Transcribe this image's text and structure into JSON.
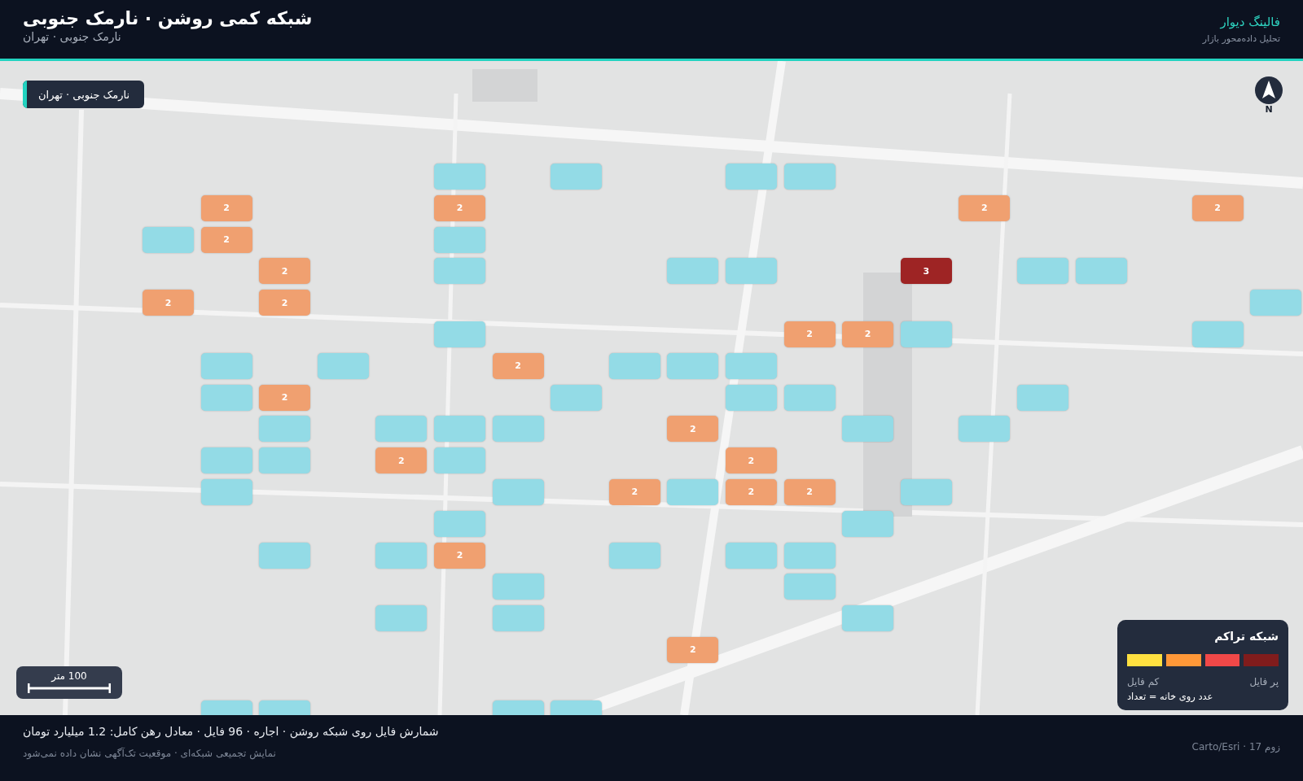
{
  "header": {
    "title": "شبکه کمی روشن · نارمک جنوبی",
    "subtitle": "نارمک جنوبی · تهران",
    "brand": "فالینگ دیوار",
    "tagline": "تحلیل داده‌محور بازار"
  },
  "map": {
    "kind": "picture",
    "location_badge": "نارمک جنوبی · تهران",
    "north_label": "N",
    "scale_label": "100 متر",
    "grid_rows": [
      {
        "cells": [
          {},
          {},
          {},
          {},
          {},
          {},
          {},
          {},
          {
            "color": "#93dbe6"
          },
          {
            "color": "#93dbe6"
          },
          {},
          {},
          {
            "color": "#93dbe6"
          },
          {},
          {
            "color": "#93dbe6"
          },
          {},
          {},
          {},
          {},
          {}
        ]
      },
      {
        "cells": [
          {},
          {
            "color": "#f0a070",
            "count": "2"
          },
          {},
          {},
          {},
          {
            "color": "#f0a070",
            "count": "2"
          },
          {},
          {},
          {},
          {},
          {},
          {},
          {},
          {},
          {
            "color": "#f0a070",
            "count": "2"
          },
          {},
          {},
          {},
          {
            "color": "#f0a070",
            "count": "2"
          },
          {}
        ]
      },
      {
        "cells": [
          {},
          {},
          {},
          {},
          {},
          {},
          {},
          {},
          {},
          {},
          {},
          {},
          {},
          {},
          {
            "color": "#93dbe6"
          },
          {},
          {},
          {},
          {
            "color": "#f0a070",
            "count": "2"
          },
          {
            "color": "#93dbe6"
          }
        ]
      },
      {
        "cells": [
          {},
          {},
          {},
          {
            "color": "#93dbe6"
          },
          {
            "color": "#93dbe6"
          },
          {},
          {
            "color": "#9e2424",
            "count": "3"
          },
          {},
          {},
          {
            "color": "#93dbe6"
          },
          {
            "color": "#93dbe6"
          },
          {},
          {},
          {},
          {
            "color": "#93dbe6"
          },
          {},
          {},
          {
            "color": "#f0a070",
            "count": "2"
          },
          {},
          {}
        ]
      },
      {
        "cells": [
          {
            "color": "#93dbe6"
          },
          {},
          {},
          {},
          {},
          {},
          {},
          {},
          {},
          {},
          {},
          {},
          {},
          {},
          {},
          {},
          {},
          {
            "color": "#f0a070",
            "count": "2"
          },
          {},
          {
            "color": "#f0a070",
            "count": "2"
          }
        ]
      },
      {
        "cells": [
          {},
          {
            "color": "#93dbe6"
          },
          {},
          {},
          {},
          {},
          {
            "color": "#93dbe6"
          },
          {
            "color": "#f0a070",
            "count": "2"
          },
          {
            "color": "#f0a070",
            "count": "2"
          },
          {},
          {},
          {},
          {},
          {},
          {
            "color": "#93dbe6"
          },
          {},
          {},
          {},
          {},
          {}
        ]
      },
      {
        "cells": [
          {},
          {},
          {},
          {},
          {},
          {},
          {},
          {},
          {},
          {
            "color": "#93dbe6"
          },
          {
            "color": "#93dbe6"
          },
          {
            "color": "#93dbe6"
          },
          {},
          {
            "color": "#f0a070",
            "count": "2"
          },
          {},
          {},
          {
            "color": "#93dbe6"
          },
          {},
          {
            "color": "#93dbe6"
          },
          {}
        ]
      },
      {
        "cells": [
          {},
          {},
          {},
          {},
          {
            "color": "#93dbe6"
          },
          {},
          {},
          {},
          {
            "color": "#93dbe6"
          },
          {
            "color": "#93dbe6"
          },
          {},
          {},
          {
            "color": "#93dbe6"
          },
          {},
          {},
          {},
          {},
          {
            "color": "#f0a070",
            "count": "2"
          },
          {
            "color": "#93dbe6"
          },
          {}
        ]
      },
      {
        "cells": [
          {},
          {},
          {},
          {},
          {},
          {
            "color": "#93dbe6"
          },
          {},
          {
            "color": "#93dbe6"
          },
          {},
          {},
          {
            "color": "#f0a070",
            "count": "2"
          },
          {},
          {},
          {
            "color": "#93dbe6"
          },
          {
            "color": "#93dbe6"
          },
          {
            "color": "#93dbe6"
          },
          {},
          {
            "color": "#93dbe6"
          },
          {},
          {}
        ]
      },
      {
        "cells": [
          {},
          {},
          {},
          {},
          {},
          {},
          {},
          {},
          {},
          {
            "color": "#f0a070",
            "count": "2"
          },
          {},
          {},
          {},
          {},
          {
            "color": "#93dbe6"
          },
          {
            "color": "#f0a070",
            "count": "2"
          },
          {},
          {
            "color": "#93dbe6"
          },
          {
            "color": "#93dbe6"
          },
          {}
        ]
      },
      {
        "cells": [
          {},
          {},
          {},
          {},
          {},
          {},
          {
            "color": "#93dbe6"
          },
          {},
          {
            "color": "#f0a070",
            "count": "2"
          },
          {
            "color": "#f0a070",
            "count": "2"
          },
          {
            "color": "#93dbe6"
          },
          {
            "color": "#f0a070",
            "count": "2"
          },
          {},
          {
            "color": "#93dbe6"
          },
          {},
          {},
          {},
          {},
          {
            "color": "#93dbe6"
          },
          {}
        ]
      },
      {
        "cells": [
          {},
          {},
          {},
          {},
          {},
          {},
          {},
          {
            "color": "#93dbe6"
          },
          {},
          {},
          {},
          {},
          {},
          {},
          {
            "color": "#93dbe6"
          },
          {},
          {},
          {},
          {},
          {}
        ]
      },
      {
        "cells": [
          {},
          {},
          {},
          {},
          {},
          {},
          {},
          {},
          {
            "color": "#93dbe6"
          },
          {
            "color": "#93dbe6"
          },
          {},
          {
            "color": "#93dbe6"
          },
          {},
          {},
          {
            "color": "#f0a070",
            "count": "2"
          },
          {
            "color": "#93dbe6"
          },
          {},
          {
            "color": "#93dbe6"
          },
          {},
          {}
        ]
      },
      {
        "cells": [
          {},
          {},
          {},
          {},
          {},
          {},
          {},
          {},
          {
            "color": "#93dbe6"
          },
          {},
          {},
          {},
          {},
          {
            "color": "#93dbe6"
          },
          {},
          {},
          {},
          {},
          {},
          {}
        ]
      },
      {
        "cells": [
          {},
          {},
          {},
          {},
          {},
          {},
          {},
          {
            "color": "#93dbe6"
          },
          {},
          {},
          {},
          {},
          {},
          {
            "color": "#93dbe6"
          },
          {},
          {
            "color": "#93dbe6"
          },
          {},
          {},
          {},
          {}
        ]
      },
      {
        "cells": [
          {},
          {},
          {},
          {},
          {},
          {},
          {},
          {},
          {},
          {},
          {
            "color": "#f0a070",
            "count": "2"
          },
          {},
          {},
          {},
          {},
          {},
          {},
          {},
          {},
          {}
        ]
      },
      {
        "cells": [
          {},
          {},
          {},
          {},
          {},
          {},
          {},
          {},
          {},
          {},
          {},
          {},
          {},
          {},
          {},
          {},
          {},
          {},
          {},
          {}
        ]
      },
      {
        "cells": [
          {},
          {},
          {},
          {},
          {},
          {},
          {},
          {},
          {},
          {},
          {},
          {},
          {
            "color": "#93dbe6"
          },
          {
            "color": "#93dbe6"
          },
          {},
          {},
          {},
          {
            "color": "#93dbe6"
          },
          {
            "color": "#93dbe6"
          },
          {}
        ]
      }
    ]
  },
  "legend": {
    "title": "شبکه تراکم",
    "swatches": [
      {
        "color": "#ffe040"
      },
      {
        "color": "#ff9838"
      },
      {
        "color": "#f04848"
      },
      {
        "color": "#801c1c"
      }
    ],
    "high_label": "پر فایل",
    "low_label": "کم فایل",
    "note": "عدد روی خانه = تعداد"
  },
  "footer": {
    "summary": "شمارش فایل روی شبکه روشن · اجاره · 96 فایل · معادل رهن کامل: 1.2 میلیارد تومان",
    "note": "نمایش تجمیعی شبکه‌ای · موقعیت تک‌آگهی نشان داده نمی‌شود",
    "attribution": "زوم 17 · Carto/Esri"
  }
}
